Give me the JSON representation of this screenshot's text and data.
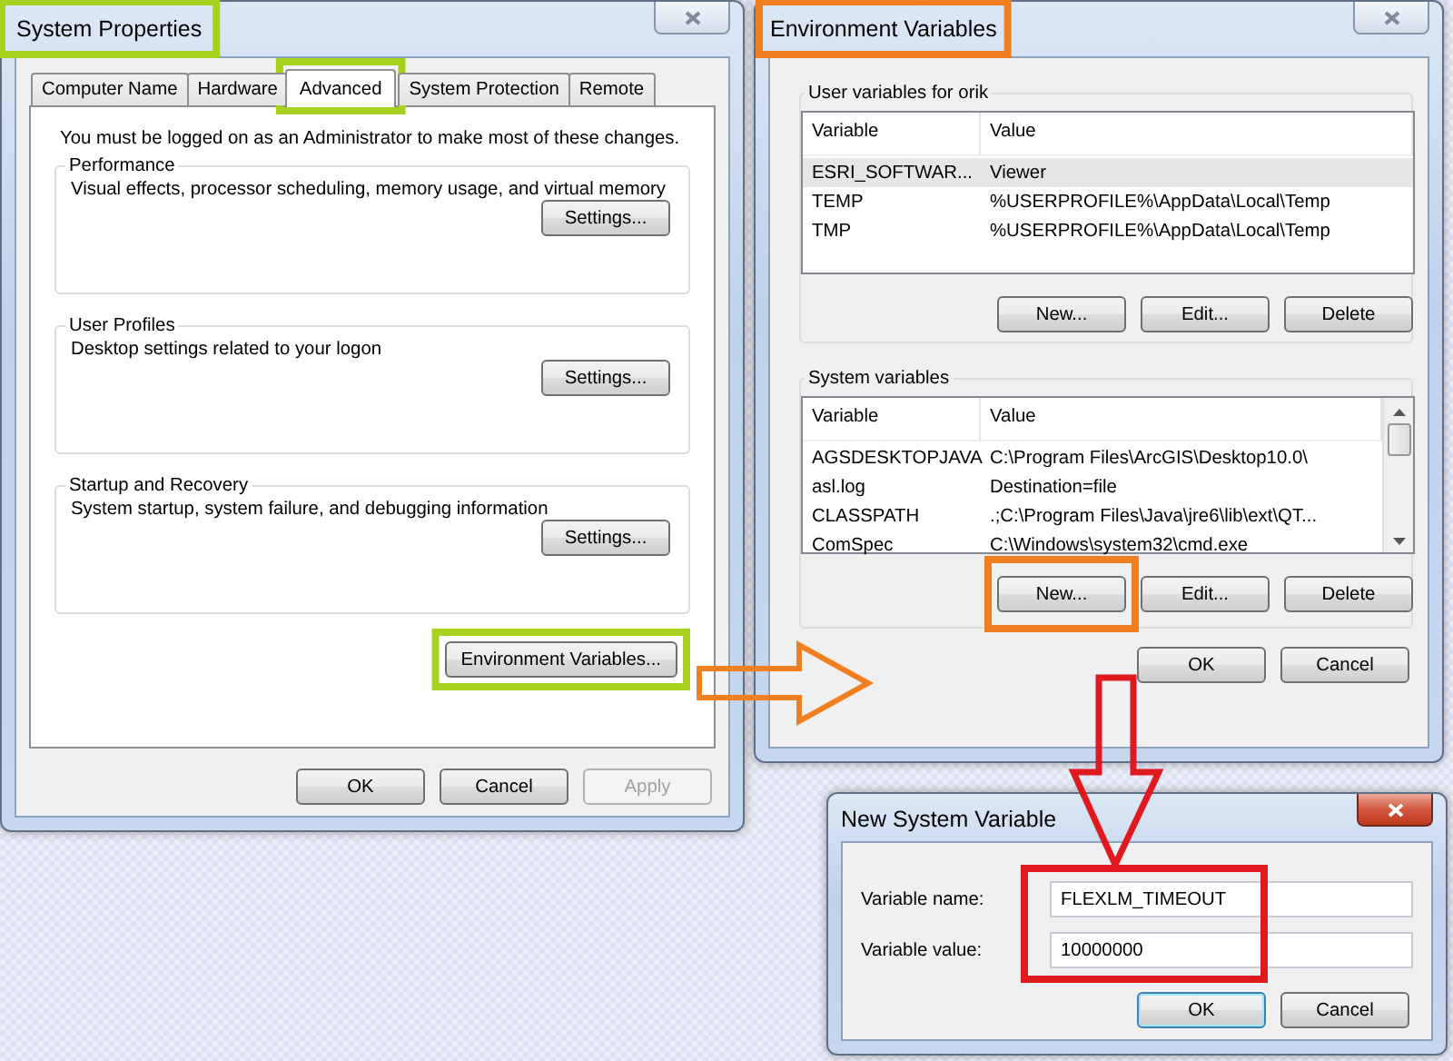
{
  "system_properties": {
    "title": "System Properties",
    "active": false,
    "tabs": [
      {
        "label": "Computer Name",
        "selected": false
      },
      {
        "label": "Hardware",
        "selected": false
      },
      {
        "label": "Advanced",
        "selected": true
      },
      {
        "label": "System Protection",
        "selected": false
      },
      {
        "label": "Remote",
        "selected": false
      }
    ],
    "notice": "You must be logged on as an Administrator to make most of these changes.",
    "groups": [
      {
        "title": "Performance",
        "description": "Visual effects, processor scheduling, memory usage, and virtual memory",
        "button": "Settings..."
      },
      {
        "title": "User Profiles",
        "description": "Desktop settings related to your logon",
        "button": "Settings..."
      },
      {
        "title": "Startup and Recovery",
        "description": "System startup, system failure, and debugging information",
        "button": "Settings..."
      }
    ],
    "environment_button": "Environment Variables...",
    "buttons": [
      {
        "label": "OK",
        "disabled": false
      },
      {
        "label": "Cancel",
        "disabled": false
      },
      {
        "label": "Apply",
        "disabled": true
      }
    ]
  },
  "environment_variables": {
    "title": "Environment Variables",
    "active": false,
    "sections": [
      {
        "title": "User variables for orik",
        "columns": [
          "Variable",
          "Value"
        ],
        "scrollbar": false,
        "rows": [
          {
            "variable": "ESRI_SOFTWAR...",
            "value": "Viewer",
            "selected": true
          },
          {
            "variable": "TEMP",
            "value": "%USERPROFILE%\\AppData\\Local\\Temp",
            "selected": false
          },
          {
            "variable": "TMP",
            "value": "%USERPROFILE%\\AppData\\Local\\Temp",
            "selected": false
          }
        ],
        "buttons": [
          "New...",
          "Edit...",
          "Delete"
        ]
      },
      {
        "title": "System variables",
        "columns": [
          "Variable",
          "Value"
        ],
        "scrollbar": true,
        "rows": [
          {
            "variable": "AGSDESKTOPJAVA",
            "value": "C:\\Program Files\\ArcGIS\\Desktop10.0\\",
            "selected": false
          },
          {
            "variable": "asl.log",
            "value": "Destination=file",
            "selected": false
          },
          {
            "variable": "CLASSPATH",
            "value": ".;C:\\Program Files\\Java\\jre6\\lib\\ext\\QT...",
            "selected": false
          },
          {
            "variable": "ComSpec",
            "value": "C:\\Windows\\system32\\cmd.exe",
            "selected": false
          }
        ],
        "buttons": [
          "New...",
          "Edit...",
          "Delete"
        ]
      }
    ],
    "buttons": [
      "OK",
      "Cancel"
    ]
  },
  "new_system_variable": {
    "title": "New System Variable",
    "active": true,
    "fields": [
      {
        "label": "Variable name:",
        "value": "FLEXLM_TIMEOUT"
      },
      {
        "label": "Variable value:",
        "value": "10000000"
      }
    ],
    "buttons": [
      {
        "label": "OK",
        "default": true
      },
      {
        "label": "Cancel",
        "default": false
      }
    ]
  }
}
